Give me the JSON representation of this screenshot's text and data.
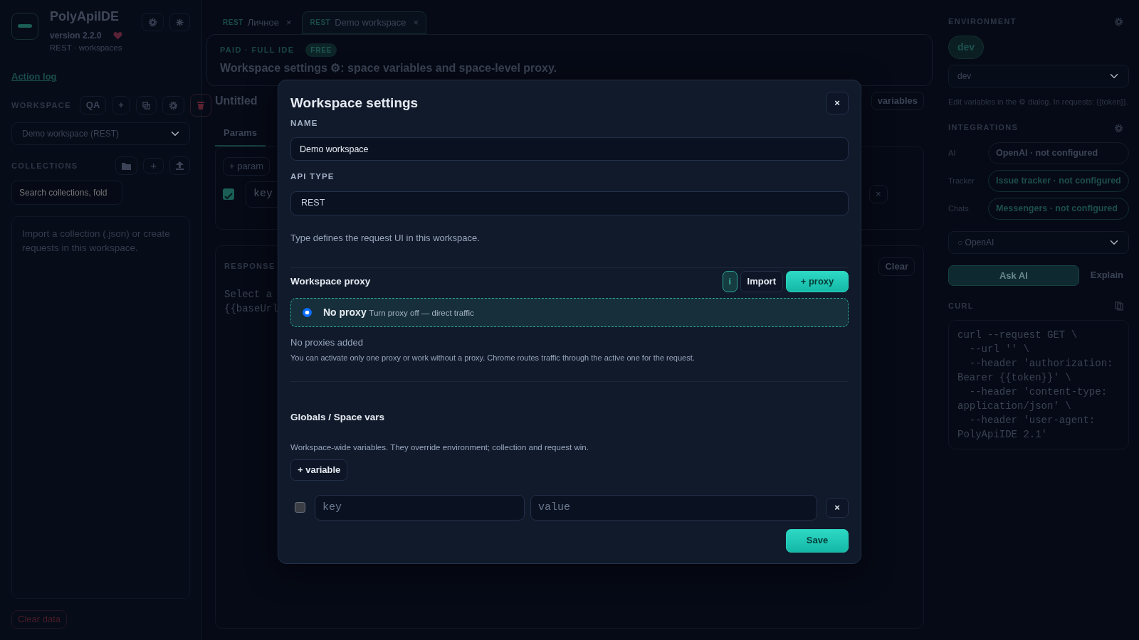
{
  "sidebar": {
    "app_name": "PolyApiIDE",
    "version": "version 2.2.0",
    "subtitle": "REST · workspaces",
    "action_log": "Action log",
    "workspace_label": "WORKSPACE",
    "workspace_badge": "QA",
    "workspace_add": "+",
    "workspace_select": "Demo workspace (REST)",
    "collections_label": "COLLECTIONS",
    "collections_add": "+",
    "search": {
      "placeholder": "Search collections, fold"
    },
    "empty_text": "Import a collection (.json) or create requests in this workspace.",
    "clear_button": "Clear data"
  },
  "tabs": [
    {
      "method": "REST",
      "label": "Личное",
      "close": "×",
      "selected": false
    },
    {
      "method": "REST",
      "label": "Demo workspace",
      "close": "×",
      "selected": true
    }
  ],
  "banner": {
    "eyebrow": "PAID · FULL IDE",
    "badge": "FREE",
    "text": "Workspace settings ⚙: space variables and space-level proxy."
  },
  "request": {
    "title": "Untitled",
    "variables_button": "variables",
    "tabs": [
      {
        "label": "Params",
        "selected": true
      }
    ],
    "add_button": "+ param",
    "params": [
      {
        "checked": true,
        "key_placeholder": "key",
        "remove": "×"
      }
    ]
  },
  "response": {
    "label": "RESPONSE",
    "clear_button": "Clear",
    "lines": [
      "Select a",
      "{{baseUrl"
    ]
  },
  "environment": {
    "label": "ENVIRONMENT",
    "chip": "dev",
    "select": "dev",
    "hint": "Edit variables in the ⚙ dialog. In requests: {{token}}."
  },
  "integrations": {
    "label": "INTEGRATIONS",
    "rows": [
      {
        "label": "AI",
        "value": "OpenAI · not configured",
        "kind": "plain"
      },
      {
        "label": "Tracker",
        "value": "Issue tracker · not configured",
        "kind": "accent"
      },
      {
        "label": "Chats",
        "value": "Messengers · not configured",
        "kind": "accent"
      }
    ],
    "provider_select": "○ OpenAI",
    "ask_button": "Ask AI",
    "explain_button": "Explain"
  },
  "curl": {
    "label": "CURL",
    "code": "curl --request GET \\\n  --url '' \\\n  --header 'authorization:\nBearer {{token}}' \\\n  --header 'content-type:\napplication/json' \\\n  --header 'user-agent:\nPolyApiIDE 2.1'"
  },
  "dialog": {
    "title": "Workspace settings",
    "close": "×",
    "name_label": "NAME",
    "name_value": "Demo workspace",
    "type_label": "API TYPE",
    "type_value": "REST",
    "type_hint": "Type defines the request UI in this workspace.",
    "proxy": {
      "title": "Workspace proxy",
      "info_button": "i",
      "import_button": "Import",
      "add_button": "+ proxy",
      "options": [
        {
          "title": "No proxy",
          "detail": "Turn proxy off — direct traffic",
          "selected": true
        }
      ],
      "empty": "No proxies added",
      "note": "You can activate only one proxy or work without a proxy. Chrome routes traffic through the active one for the request."
    },
    "globals": {
      "title": "Globals / Space vars",
      "description": "Workspace-wide variables. They override environment; collection and request win.",
      "add_button": "+ variable",
      "variables": [
        {
          "checked": false,
          "key_placeholder": "key",
          "value_placeholder": "value",
          "remove": "×"
        }
      ]
    },
    "save_button": "Save"
  }
}
